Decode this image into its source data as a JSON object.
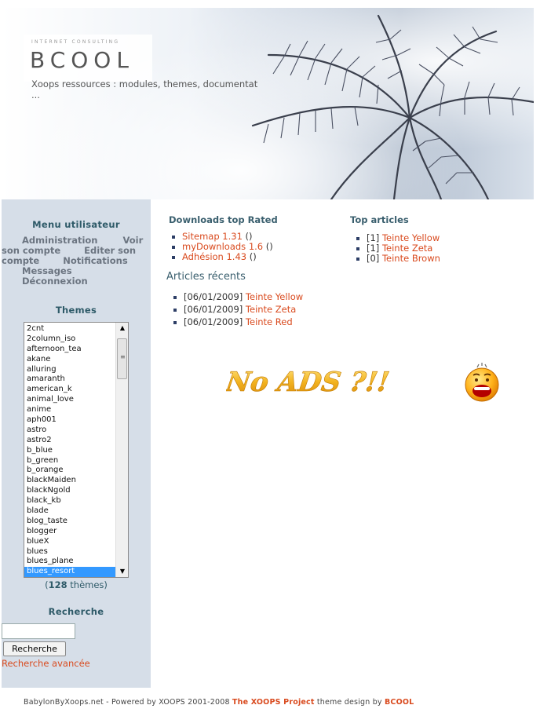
{
  "header": {
    "logo_sub": "INTERNET CONSULTING",
    "logo": "BCOOL",
    "slogan": "Xoops ressources : modules, themes, documentat",
    "slogan_ellipsis": "..."
  },
  "user_menu": {
    "title": "Menu utilisateur",
    "items": [
      "Administration",
      "Voir son compte",
      "Editer son compte",
      "Notifications",
      "Messages",
      "Déconnexion"
    ]
  },
  "themes": {
    "title": "Themes",
    "items": [
      "2cnt",
      "2column_iso",
      "afternoon_tea",
      "akane",
      "alluring",
      "amaranth",
      "american_k",
      "animal_love",
      "anime",
      "aph001",
      "astro",
      "astro2",
      "b_blue",
      "b_green",
      "b_orange",
      "blackMaiden",
      "blackNgold",
      "black_kb",
      "blade",
      "blog_taste",
      "blogger",
      "blueX",
      "blues",
      "blues_plane",
      "blues_resort"
    ],
    "selected": "blues_resort",
    "count_open": "(",
    "count": "128",
    "count_suffix": " thèmes)"
  },
  "search": {
    "title": "Recherche",
    "input_value": "",
    "button_label": "Recherche",
    "advanced_label": "Recherche avancée"
  },
  "downloads": {
    "title": "Downloads top Rated",
    "items": [
      {
        "name": "Sitemap 1.31",
        "suffix": " ()"
      },
      {
        "name": "myDownloads 1.6",
        "suffix": " ()"
      },
      {
        "name": "Adhésion 1.43",
        "suffix": " ()"
      }
    ]
  },
  "top_articles": {
    "title": "Top articles",
    "items": [
      {
        "count": "[1] ",
        "name": "Teinte Yellow"
      },
      {
        "count": "[1] ",
        "name": "Teinte Zeta"
      },
      {
        "count": "[0] ",
        "name": "Teinte Brown"
      }
    ]
  },
  "recent_articles": {
    "title": "Articles récents",
    "items": [
      {
        "date": "[06/01/2009] ",
        "name": "Teinte Yellow"
      },
      {
        "date": "[06/01/2009] ",
        "name": "Teinte Zeta"
      },
      {
        "date": "[06/01/2009] ",
        "name": "Teinte Red"
      }
    ]
  },
  "banner": {
    "text": "No ADS ?!!"
  },
  "footer": {
    "prefix": "BabylonByXoops.net - Powered by XOOPS 2001-2008 ",
    "project": "The XOOPS Project",
    "middle": " theme design by ",
    "designer": "BCOOL"
  },
  "colors": {
    "link": "#d94a1e",
    "heading": "#3a5f6e",
    "sidebar_bg": "#d6dee8",
    "selected": "#3399ff"
  }
}
